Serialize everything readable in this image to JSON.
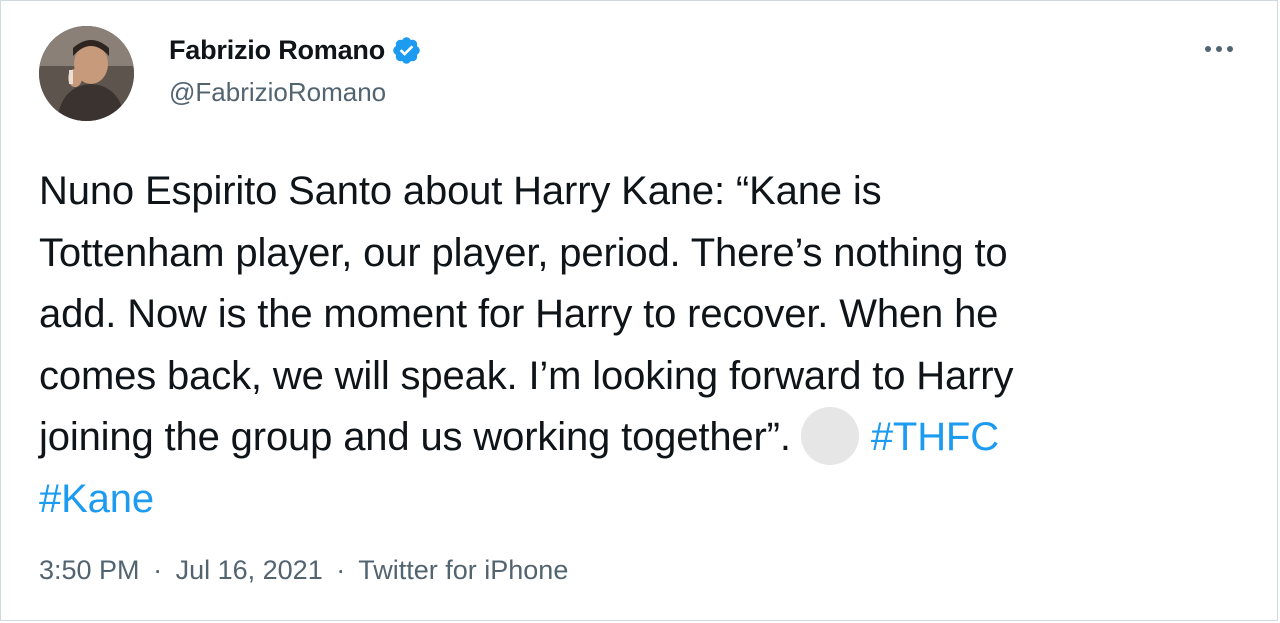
{
  "author": {
    "display_name": "Fabrizio Romano",
    "handle": "@FabrizioRomano",
    "verified_icon": "verified-badge-icon",
    "avatar_icon": "profile-photo"
  },
  "menu": {
    "more_icon": "more-options-icon"
  },
  "tweet": {
    "lines": [
      "Nuno Espirito Santo about Harry Kane: “Kane is",
      "Tottenham player, our player, period. There’s nothing to",
      "add. Now is the moment for Harry to recover. When he",
      "comes back, we will speak. I’m looking forward to Harry",
      "joining the group and us working together”."
    ],
    "hashtag_1": "#THFC",
    "hashtag_2": "#Kane"
  },
  "meta": {
    "time": "3:50 PM",
    "separator_1": "·",
    "date": "Jul 16, 2021",
    "separator_2": "·",
    "source": "Twitter for iPhone"
  },
  "colors": {
    "text": "#0f1419",
    "secondary": "#536471",
    "link": "#1d9bf0",
    "verified": "#1d9bf0",
    "border": "#cfd9de"
  }
}
